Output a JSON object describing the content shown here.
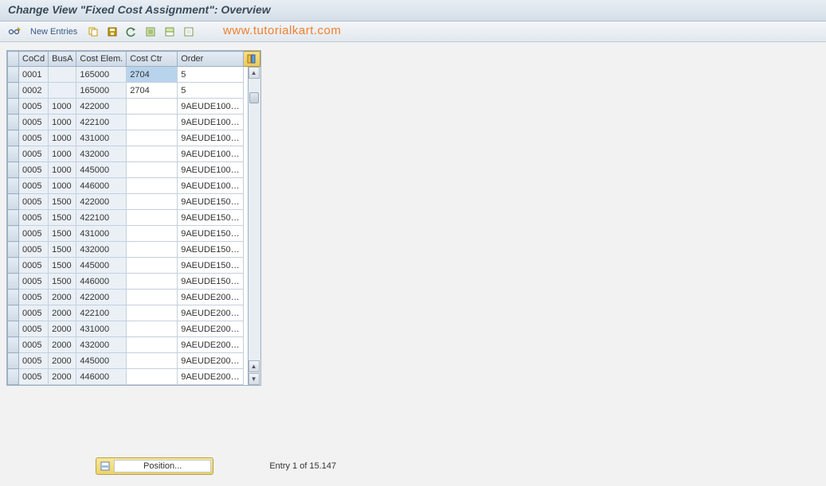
{
  "header": {
    "title": "Change View \"Fixed Cost Assignment\": Overview"
  },
  "toolbar": {
    "new_entries": "New Entries",
    "watermark": "www.tutorialkart.com",
    "icons": {
      "glasses_pencil": "display-change-icon",
      "copy": "copy-icon",
      "save": "save-icon",
      "undo": "undo-icon",
      "select_all": "select-all-icon",
      "deselect_all": "deselect-all-icon",
      "delete": "delete-icon"
    }
  },
  "grid": {
    "columns": [
      "CoCd",
      "BusA",
      "Cost Elem.",
      "Cost Ctr",
      "Order"
    ],
    "rows": [
      {
        "cocd": "0001",
        "busa": "",
        "elem": "165000",
        "ctr": "2704",
        "order": "5",
        "ctr_hl": true
      },
      {
        "cocd": "0002",
        "busa": "",
        "elem": "165000",
        "ctr": "2704",
        "order": "5"
      },
      {
        "cocd": "0005",
        "busa": "1000",
        "elem": "422000",
        "ctr": "",
        "order": "9AEUDE100…"
      },
      {
        "cocd": "0005",
        "busa": "1000",
        "elem": "422100",
        "ctr": "",
        "order": "9AEUDE100…"
      },
      {
        "cocd": "0005",
        "busa": "1000",
        "elem": "431000",
        "ctr": "",
        "order": "9AEUDE100…"
      },
      {
        "cocd": "0005",
        "busa": "1000",
        "elem": "432000",
        "ctr": "",
        "order": "9AEUDE100…"
      },
      {
        "cocd": "0005",
        "busa": "1000",
        "elem": "445000",
        "ctr": "",
        "order": "9AEUDE100…"
      },
      {
        "cocd": "0005",
        "busa": "1000",
        "elem": "446000",
        "ctr": "",
        "order": "9AEUDE100…"
      },
      {
        "cocd": "0005",
        "busa": "1500",
        "elem": "422000",
        "ctr": "",
        "order": "9AEUDE150…"
      },
      {
        "cocd": "0005",
        "busa": "1500",
        "elem": "422100",
        "ctr": "",
        "order": "9AEUDE150…"
      },
      {
        "cocd": "0005",
        "busa": "1500",
        "elem": "431000",
        "ctr": "",
        "order": "9AEUDE150…"
      },
      {
        "cocd": "0005",
        "busa": "1500",
        "elem": "432000",
        "ctr": "",
        "order": "9AEUDE150…"
      },
      {
        "cocd": "0005",
        "busa": "1500",
        "elem": "445000",
        "ctr": "",
        "order": "9AEUDE150…"
      },
      {
        "cocd": "0005",
        "busa": "1500",
        "elem": "446000",
        "ctr": "",
        "order": "9AEUDE150…"
      },
      {
        "cocd": "0005",
        "busa": "2000",
        "elem": "422000",
        "ctr": "",
        "order": "9AEUDE200…"
      },
      {
        "cocd": "0005",
        "busa": "2000",
        "elem": "422100",
        "ctr": "",
        "order": "9AEUDE200…"
      },
      {
        "cocd": "0005",
        "busa": "2000",
        "elem": "431000",
        "ctr": "",
        "order": "9AEUDE200…"
      },
      {
        "cocd": "0005",
        "busa": "2000",
        "elem": "432000",
        "ctr": "",
        "order": "9AEUDE200…"
      },
      {
        "cocd": "0005",
        "busa": "2000",
        "elem": "445000",
        "ctr": "",
        "order": "9AEUDE200…"
      },
      {
        "cocd": "0005",
        "busa": "2000",
        "elem": "446000",
        "ctr": "",
        "order": "9AEUDE200…"
      }
    ]
  },
  "footer": {
    "position_label": "Position...",
    "entry_status": "Entry 1 of 15.147"
  }
}
